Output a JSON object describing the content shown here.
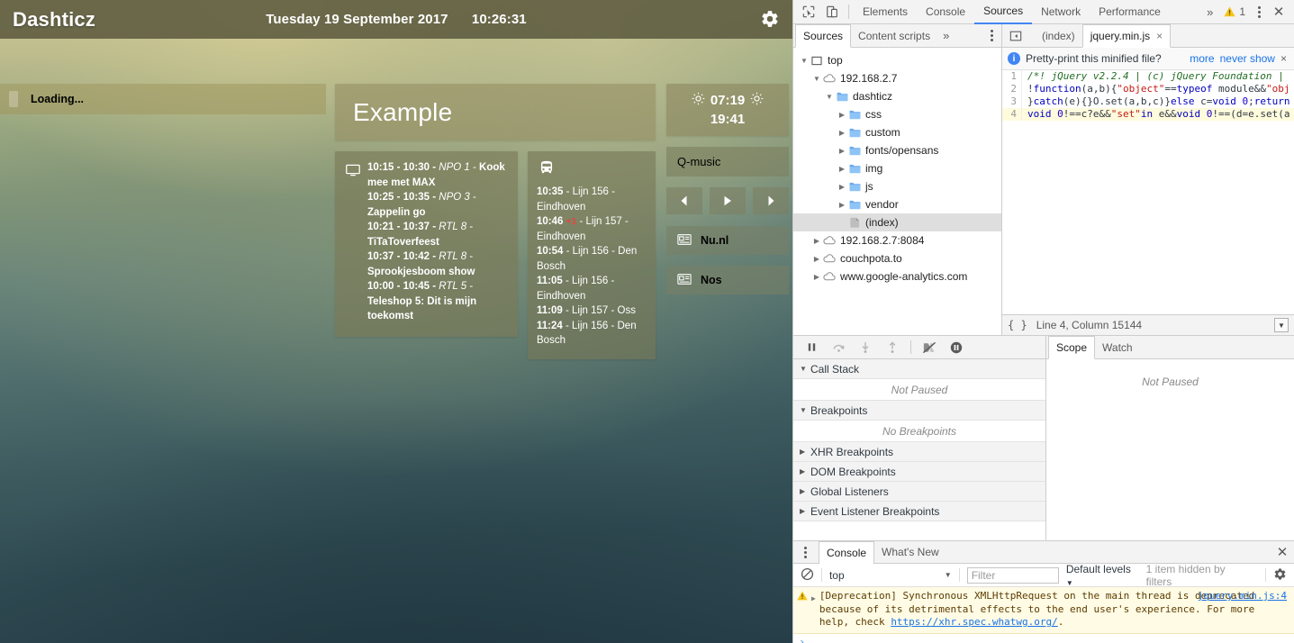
{
  "dashboard": {
    "app_title": "Dashticz",
    "date": "Tuesday 19 September 2017",
    "time": "10:26:31",
    "settings_icon": "gear-icon",
    "loading_text": "Loading...",
    "example_title": "Example",
    "tv": {
      "icon": "television-icon",
      "items": [
        {
          "time": "10:15 - 10:30 - ",
          "channel": "NPO 1",
          "sep": " - ",
          "program": "Kook mee met MAX"
        },
        {
          "time": "10:25 - 10:35 - ",
          "channel": "NPO 3",
          "sep": " - ",
          "program": "Zappelin go"
        },
        {
          "time": "10:21 - 10:37 - ",
          "channel": "RTL 8",
          "sep": " - ",
          "program": "TiTaToverfeest"
        },
        {
          "time": "10:37 - 10:42 - ",
          "channel": "RTL 8",
          "sep": " - ",
          "program": "Sprookjesboom show"
        },
        {
          "time": "10:00 - 10:45 - ",
          "channel": "RTL 5",
          "sep": " - ",
          "program": "Teleshop 5: Dit is mijn toekomst"
        }
      ]
    },
    "bus": {
      "icon": "bus-icon",
      "items": [
        {
          "time": "10:35",
          "delay": "",
          "rest": " - Lijn 156 - Eindhoven"
        },
        {
          "time": "10:46",
          "delay": "+1",
          "rest": " - Lijn 157 - Eindhoven"
        },
        {
          "time": "10:54",
          "delay": "",
          "rest": " - Lijn 156 - Den Bosch"
        },
        {
          "time": "11:05",
          "delay": "",
          "rest": " - Lijn 156 - Eindhoven"
        },
        {
          "time": "11:09",
          "delay": "",
          "rest": " - Lijn 157 - Oss"
        },
        {
          "time": "11:24",
          "delay": "",
          "rest": " - Lijn 156 - Den Bosch"
        }
      ]
    },
    "sun": {
      "sunrise_icon": "sunrise-icon",
      "sunrise": "07:19",
      "sunset_icon": "sunset-icon",
      "sunset": "19:41"
    },
    "radio": {
      "station": "Q-music",
      "prev": "‹",
      "play": "▶",
      "next": "›"
    },
    "news": [
      {
        "icon": "newspaper-icon",
        "label": "Nu.nl"
      },
      {
        "icon": "newspaper-icon",
        "label": "Nos"
      }
    ]
  },
  "devtools": {
    "toolbar": {
      "inspect_icon": "inspect-element-icon",
      "device_icon": "device-toolbar-icon",
      "tabs": [
        {
          "label": "Elements",
          "active": false
        },
        {
          "label": "Console",
          "active": false
        },
        {
          "label": "Sources",
          "active": true
        },
        {
          "label": "Network",
          "active": false
        },
        {
          "label": "Performance",
          "active": false
        }
      ],
      "overflow": "»",
      "warning_count": "1",
      "warning_icon": "warning-triangle-icon",
      "menu_icon": "more-options-icon",
      "close_icon": "close-icon"
    },
    "navigator": {
      "tabs": [
        {
          "label": "Sources",
          "active": true
        },
        {
          "label": "Content scripts",
          "active": false
        }
      ],
      "overflow": "»",
      "menu_icon": "more-options-icon",
      "tree": [
        {
          "label": "top",
          "depth": 0,
          "twisty": "▼",
          "icon": "frame-icon",
          "selected": false
        },
        {
          "label": "192.168.2.7",
          "depth": 1,
          "twisty": "▼",
          "icon": "cloud-icon",
          "selected": false
        },
        {
          "label": "dashticz",
          "depth": 2,
          "twisty": "▼",
          "icon": "folder-icon",
          "selected": false
        },
        {
          "label": "css",
          "depth": 3,
          "twisty": "▶",
          "icon": "folder-icon",
          "selected": false
        },
        {
          "label": "custom",
          "depth": 3,
          "twisty": "▶",
          "icon": "folder-icon",
          "selected": false
        },
        {
          "label": "fonts/opensans",
          "depth": 3,
          "twisty": "▶",
          "icon": "folder-icon",
          "selected": false
        },
        {
          "label": "img",
          "depth": 3,
          "twisty": "▶",
          "icon": "folder-icon",
          "selected": false
        },
        {
          "label": "js",
          "depth": 3,
          "twisty": "▶",
          "icon": "folder-icon",
          "selected": false
        },
        {
          "label": "vendor",
          "depth": 3,
          "twisty": "▶",
          "icon": "folder-icon",
          "selected": false
        },
        {
          "label": "(index)",
          "depth": 3,
          "twisty": "",
          "icon": "document-icon",
          "selected": true
        },
        {
          "label": "192.168.2.7:8084",
          "depth": 1,
          "twisty": "▶",
          "icon": "cloud-icon",
          "selected": false
        },
        {
          "label": "couchpota.to",
          "depth": 1,
          "twisty": "▶",
          "icon": "cloud-icon",
          "selected": false
        },
        {
          "label": "www.google-analytics.com",
          "depth": 1,
          "twisty": "▶",
          "icon": "cloud-icon",
          "selected": false
        }
      ]
    },
    "editor": {
      "back_icon": "show-navigator-icon",
      "tabs": [
        {
          "label": "(index)",
          "active": false,
          "closable": false
        },
        {
          "label": "jquery.min.js",
          "active": true,
          "closable": true
        }
      ],
      "close_glyph": "×",
      "prettyprint": {
        "info_icon": "info-icon",
        "text": "Pretty-print this minified file?",
        "more": "more",
        "never": "never show",
        "close": "×"
      },
      "lines": [
        {
          "n": "1",
          "highlight": false,
          "text": "/*! jQuery v2.2.4 | (c) jQuery Foundation | ",
          "kind": "comment"
        },
        {
          "n": "2",
          "highlight": false,
          "text": "!function(a,b){\"object\"==typeof module&&\"obj",
          "kind": "code"
        },
        {
          "n": "3",
          "highlight": false,
          "text": "}catch(e){}O.set(a,b,c)}else c=void 0;return",
          "kind": "code"
        },
        {
          "n": "4",
          "highlight": true,
          "text": "void 0!==c?e&&\"set\"in e&&void 0!==(d=e.set(a",
          "kind": "code"
        }
      ],
      "status": {
        "braces": "{ }",
        "position": "Line 4, Column 15144",
        "more_icon": "show-more-icon"
      }
    },
    "debugger": {
      "buttons": [
        {
          "icon": "pause-icon",
          "name": "pause-script-execution"
        },
        {
          "icon": "step-over-icon",
          "name": "step-over-next-function-call"
        },
        {
          "icon": "step-into-icon",
          "name": "step-into-next-function-call"
        },
        {
          "icon": "step-out-icon",
          "name": "step-out-of-current-function"
        },
        {
          "icon": "deactivate-breakpoints-icon",
          "name": "deactivate-breakpoints"
        },
        {
          "icon": "pause-on-exceptions-icon",
          "name": "pause-on-exceptions"
        }
      ],
      "sections": [
        {
          "label": "Call Stack",
          "twisty": "▼",
          "empty": "Not Paused",
          "expanded": true
        },
        {
          "label": "Breakpoints",
          "twisty": "▼",
          "empty": "No Breakpoints",
          "expanded": true
        },
        {
          "label": "XHR Breakpoints",
          "twisty": "▶",
          "empty": "",
          "expanded": false
        },
        {
          "label": "DOM Breakpoints",
          "twisty": "▶",
          "empty": "",
          "expanded": false
        },
        {
          "label": "Global Listeners",
          "twisty": "▶",
          "empty": "",
          "expanded": false
        },
        {
          "label": "Event Listener Breakpoints",
          "twisty": "▶",
          "empty": "",
          "expanded": false
        }
      ],
      "scope_tabs": [
        {
          "label": "Scope",
          "active": true
        },
        {
          "label": "Watch",
          "active": false
        }
      ],
      "scope_empty": "Not Paused"
    },
    "drawer": {
      "menu_icon": "more-options-icon",
      "tabs": [
        {
          "label": "Console",
          "active": true
        },
        {
          "label": "What's New",
          "active": false
        }
      ],
      "close_icon": "close-icon",
      "clear_icon": "clear-console-icon",
      "context": "top",
      "context_caret": "▼",
      "filter_placeholder": "Filter",
      "levels": "Default levels",
      "levels_caret": "▼",
      "hidden_note": "1 item hidden by filters",
      "settings_icon": "gear-icon",
      "messages": [
        {
          "severity": "warning",
          "severity_icon": "warning-triangle-icon",
          "expander": "▶",
          "text_before": "[Deprecation] Synchronous XMLHttpRequest on the main thread is deprecated because of its detrimental effects to the end user's experience. For more help, check ",
          "link": "https://xhr.spec.whatwg.org/",
          "text_after": ".",
          "source": "jquery.min.js:4"
        }
      ],
      "prompt": "›"
    }
  }
}
